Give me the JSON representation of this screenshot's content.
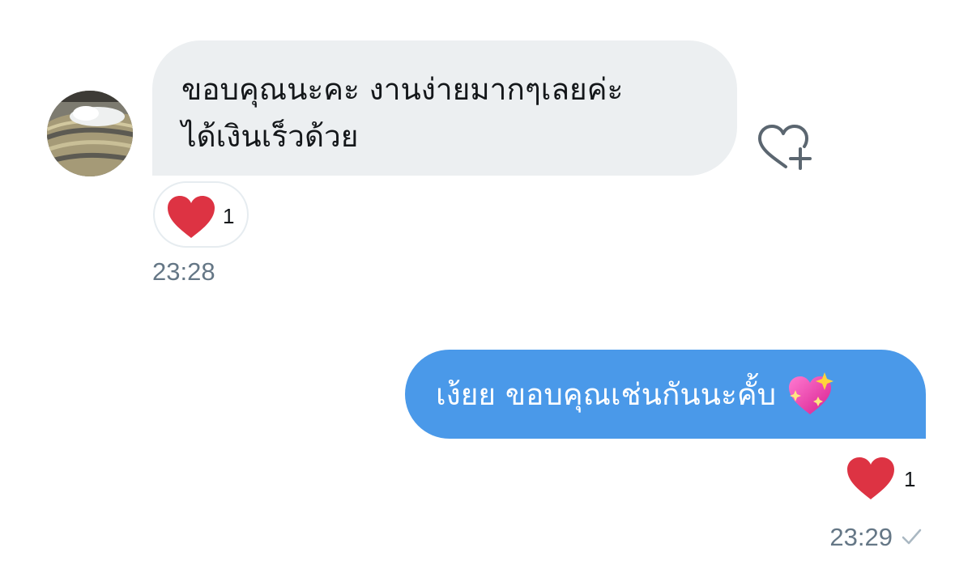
{
  "incoming": {
    "avatar": "avatar-photo",
    "text_lines": [
      "ขอบคุณนะคะ งานง่ายมากๆเลยค่ะ",
      "ได้เงินเร็วด้วย"
    ],
    "like_action_icon": "heart-plus-icon",
    "reaction": {
      "icon": "red-heart-icon",
      "count": "1"
    },
    "time": "23:28"
  },
  "outgoing": {
    "text": "เง้ยย ขอบคุณเช่นกันนะคั้บ",
    "emoji": "sparkling-heart-emoji",
    "reaction": {
      "icon": "red-heart-icon",
      "count": "1"
    },
    "time": "23:29",
    "status_icon": "check-icon"
  },
  "colors": {
    "incoming_bubble": "#eceff1",
    "outgoing_bubble": "#4a99e9",
    "heart": "#e0245e",
    "timestamp": "#657786"
  }
}
